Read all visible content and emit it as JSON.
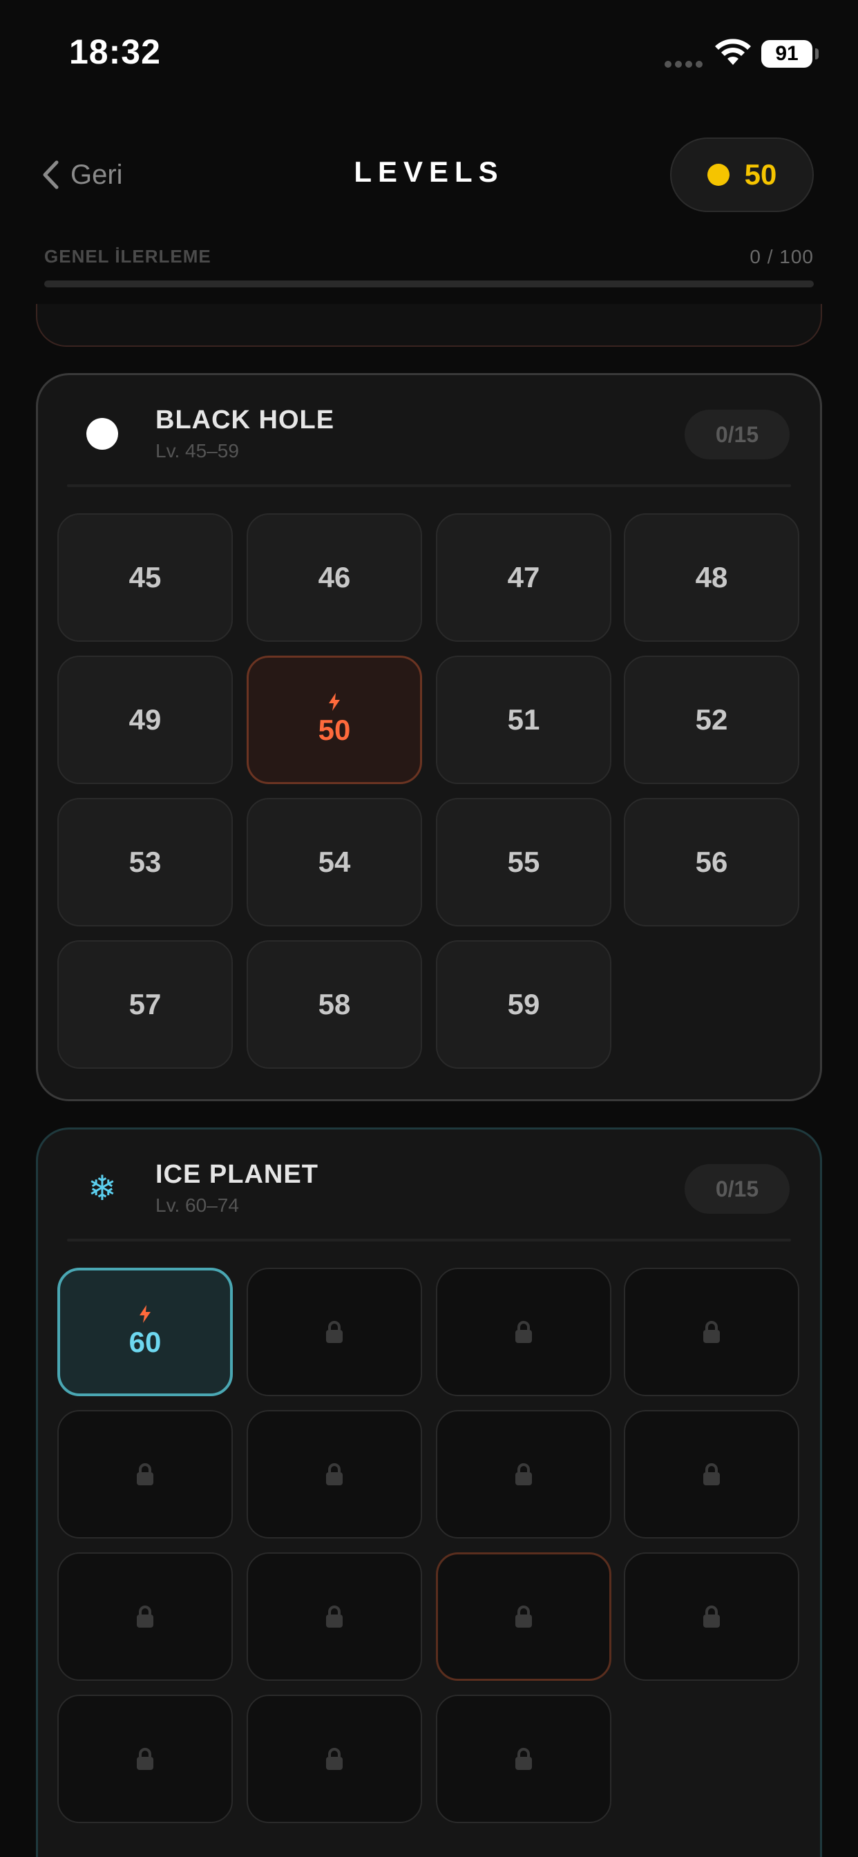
{
  "status_bar": {
    "time": "18:32",
    "battery": "91"
  },
  "header": {
    "back_label": "Geri",
    "title": "LEVELS",
    "coins": "50"
  },
  "progress": {
    "label": "GENEL İLERLEME",
    "count": "0 / 100",
    "fraction": 0
  },
  "worlds": [
    {
      "name": "BLACK HOLE",
      "range": "Lv. 45–59",
      "count": "0/15",
      "icon": "white-circle-icon",
      "levels": [
        "45",
        "46",
        "47",
        "48",
        "49",
        "50",
        "51",
        "52",
        "53",
        "54",
        "55",
        "56",
        "57",
        "58",
        "59"
      ],
      "current_level": "50"
    },
    {
      "name": "ICE PLANET",
      "range": "Lv. 60–74",
      "count": "0/15",
      "icon": "snowflake-icon",
      "icon_glyph": "❄",
      "levels": [
        "60"
      ],
      "current_level": "60",
      "locked_count": 14
    }
  ],
  "colors": {
    "coin": "#f5c400",
    "current_level": "#ff6a3c",
    "ice": "#6ed8f0",
    "background": "#0b0b0b"
  }
}
